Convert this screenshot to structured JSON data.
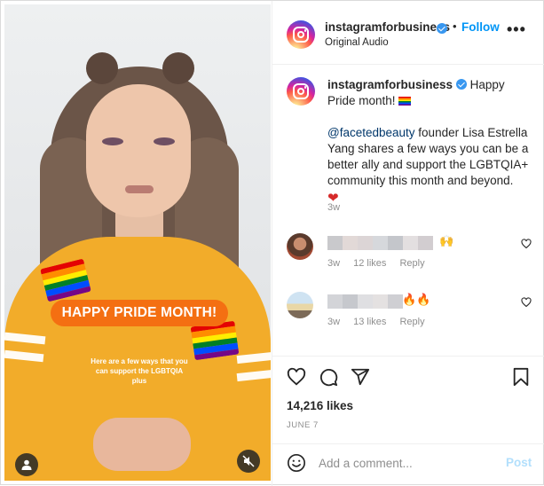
{
  "post": {
    "username": "instagramforbusiness",
    "follow_label": "Follow",
    "separator": "•",
    "audio": "Original Audio",
    "more_label": "•••"
  },
  "media": {
    "banner": "HAPPY PRIDE MONTH!",
    "overlay_text": "Here are a few ways that you can support the LGBTQIA plus",
    "pride_flag_colors": [
      "#e40303",
      "#ff8c00",
      "#ffed00",
      "#008026",
      "#004dff",
      "#750787"
    ],
    "banner_color": "#f46f12"
  },
  "caption": {
    "username": "instagramforbusiness",
    "line1": "Happy Pride month!",
    "mention": "@facetedbeauty",
    "text": "founder Lisa Estrella Yang shares a few ways you can be a better ally and support the LGBTQIA+ community this month and beyond.",
    "heart": "❤",
    "age": "3w"
  },
  "comments": [
    {
      "emoji": "🙌",
      "age": "3w",
      "likes": "12 likes",
      "reply": "Reply"
    },
    {
      "emoji": "🔥🔥",
      "age": "3w",
      "likes": "13 likes",
      "reply": "Reply"
    }
  ],
  "actions": {
    "likes": "14,216 likes",
    "date": "JUNE 7"
  },
  "add_comment": {
    "placeholder": "Add a comment...",
    "post_label": "Post"
  },
  "icons": {
    "like": "heart-outline-icon",
    "comment": "comment-bubble-icon",
    "share": "paper-plane-icon",
    "save": "bookmark-icon",
    "emoji": "smiley-icon",
    "user": "user-tag-icon",
    "mute": "muted-speaker-icon"
  },
  "colors": {
    "link": "#0095f6",
    "verified": "#3897f0",
    "muted_text": "#8e8e8e",
    "post_disabled": "#b2dffc"
  }
}
